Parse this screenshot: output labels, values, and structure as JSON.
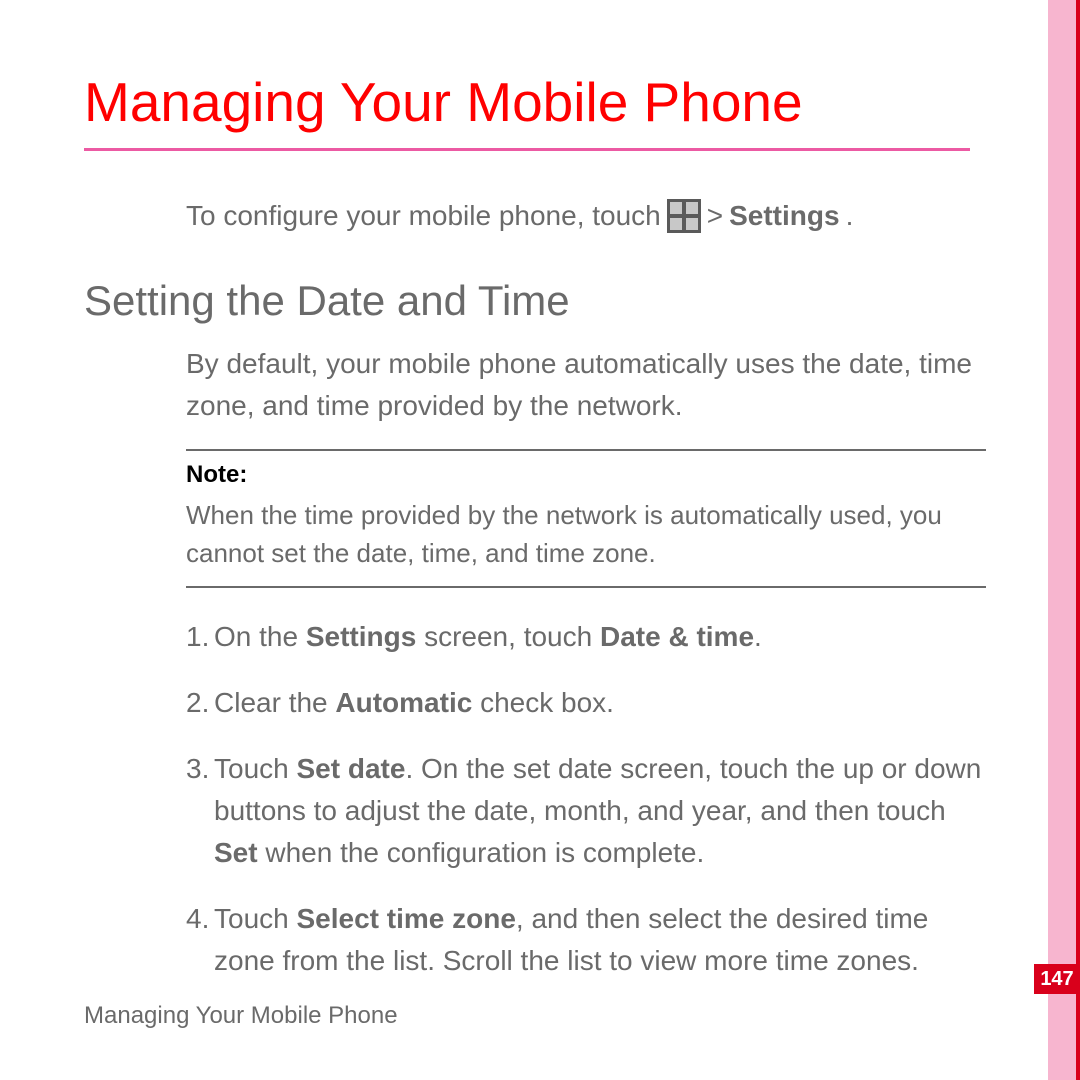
{
  "header": {
    "title": "Managing Your Mobile Phone"
  },
  "intro": {
    "before_icon": "To configure your mobile phone, touch ",
    "after_icon_gt": " > ",
    "settings_label": "Settings",
    "period": "."
  },
  "section": {
    "heading": "Setting the Date and Time",
    "paragraph": "By default, your mobile phone automatically uses the date, time zone, and time provided by the network."
  },
  "note": {
    "label": "Note:",
    "body": "When the time provided by the network is automatically used, you cannot set the date, time, and time zone."
  },
  "steps": [
    {
      "num": "1.",
      "parts": [
        "On the ",
        "Settings",
        " screen, touch ",
        "Date & time",
        "."
      ]
    },
    {
      "num": "2.",
      "parts": [
        "Clear the ",
        "Automatic",
        " check box."
      ]
    },
    {
      "num": "3.",
      "parts": [
        "Touch ",
        "Set date",
        ". On the set date screen, touch the up or down buttons to adjust the date, month, and year, and then touch ",
        "Set",
        " when the configuration is complete."
      ]
    },
    {
      "num": "4.",
      "parts": [
        "Touch ",
        "Select time zone",
        ", and then select the desired time zone from the list. Scroll the list to view more time zones."
      ]
    }
  ],
  "footer": {
    "chapter": "Managing Your Mobile Phone",
    "page_number": "147"
  }
}
